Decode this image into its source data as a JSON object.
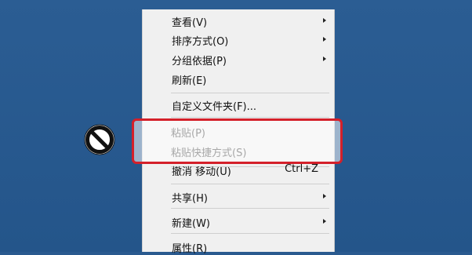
{
  "menu": {
    "items": [
      {
        "label": "查看(V)",
        "submenu": true,
        "disabled": false
      },
      {
        "label": "排序方式(O)",
        "submenu": true,
        "disabled": false
      },
      {
        "label": "分组依据(P)",
        "submenu": true,
        "disabled": false
      },
      {
        "label": "刷新(E)",
        "submenu": false,
        "disabled": false
      },
      {
        "label": "自定义文件夹(F)...",
        "submenu": false,
        "disabled": false
      },
      {
        "label": "粘贴(P)",
        "submenu": false,
        "disabled": true
      },
      {
        "label": "粘贴快捷方式(S)",
        "submenu": false,
        "disabled": true
      },
      {
        "label": "撤消 移动(U)",
        "shortcut": "Ctrl+Z",
        "submenu": false,
        "disabled": false
      },
      {
        "label": "共享(H)",
        "submenu": true,
        "disabled": false
      },
      {
        "label": "新建(W)",
        "submenu": true,
        "disabled": false
      },
      {
        "label": "属性(R)",
        "submenu": false,
        "disabled": false
      }
    ]
  },
  "icons": {
    "prohibited": "no-entry-icon",
    "submenu_arrow": "chevron-right-icon"
  },
  "colors": {
    "desktop": "#2a5a8f",
    "menu_bg": "#f0f0f0",
    "highlight_border": "#d4202a",
    "disabled_text": "#a8a8a8"
  }
}
